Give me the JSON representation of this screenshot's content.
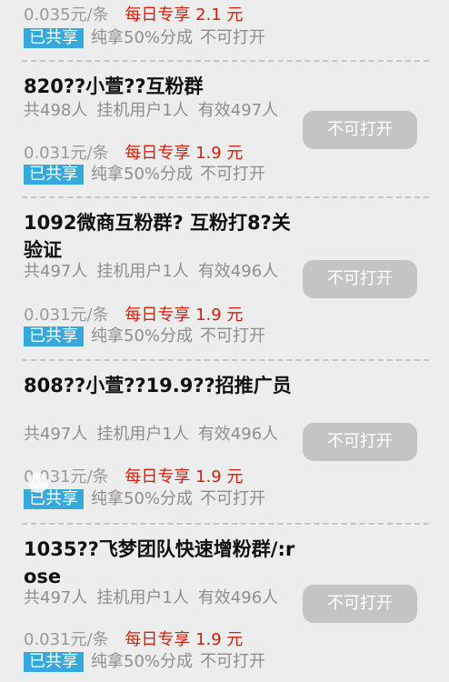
{
  "top_item": {
    "price": "0.035元/条",
    "promo": "每日专享 2.1 元",
    "badge": "已共享",
    "share_text": "纯拿50%分成",
    "status_text": "不可打开"
  },
  "items": [
    {
      "title": "820??小萱??互粉群",
      "total": "共498人",
      "bot_users": "挂机用户1人",
      "valid": "有效497人",
      "price": "0.031元/条",
      "promo": "每日专享 1.9 元",
      "badge": "已共享",
      "share_text": "纯拿50%分成",
      "status_text": "不可打开",
      "button_label": "不可打开"
    },
    {
      "title": "1092微商互粉群? 互粉打8?关验证",
      "total": "共497人",
      "bot_users": "挂机用户1人",
      "valid": "有效496人",
      "price": "0.031元/条",
      "promo": "每日专享 1.9 元",
      "badge": "已共享",
      "share_text": "纯拿50%分成",
      "status_text": "不可打开",
      "button_label": "不可打开"
    },
    {
      "title": "808??小萱??19.9??招推广员",
      "total": "共497人",
      "bot_users": "挂机用户1人",
      "valid": "有效496人",
      "price": "0.031元/条",
      "promo": "每日专享 1.9 元",
      "badge": "已共享",
      "share_text": "纯拿50%分成",
      "status_text": "不可打开",
      "button_label": "不可打开"
    },
    {
      "title": "1035??飞梦团队快速增粉群/:rose",
      "total": "共497人",
      "bot_users": "挂机用户1人",
      "valid": "有效496人",
      "price": "0.031元/条",
      "promo": "每日专享 1.9 元",
      "badge": "已共享",
      "share_text": "纯拿50%分成",
      "status_text": "不可打开",
      "button_label": "不可打开"
    }
  ],
  "colors": {
    "background": "#ededed",
    "promo_red": "#d81e06",
    "badge_blue": "#36a9d9",
    "button_gray": "#c4c4c4"
  }
}
